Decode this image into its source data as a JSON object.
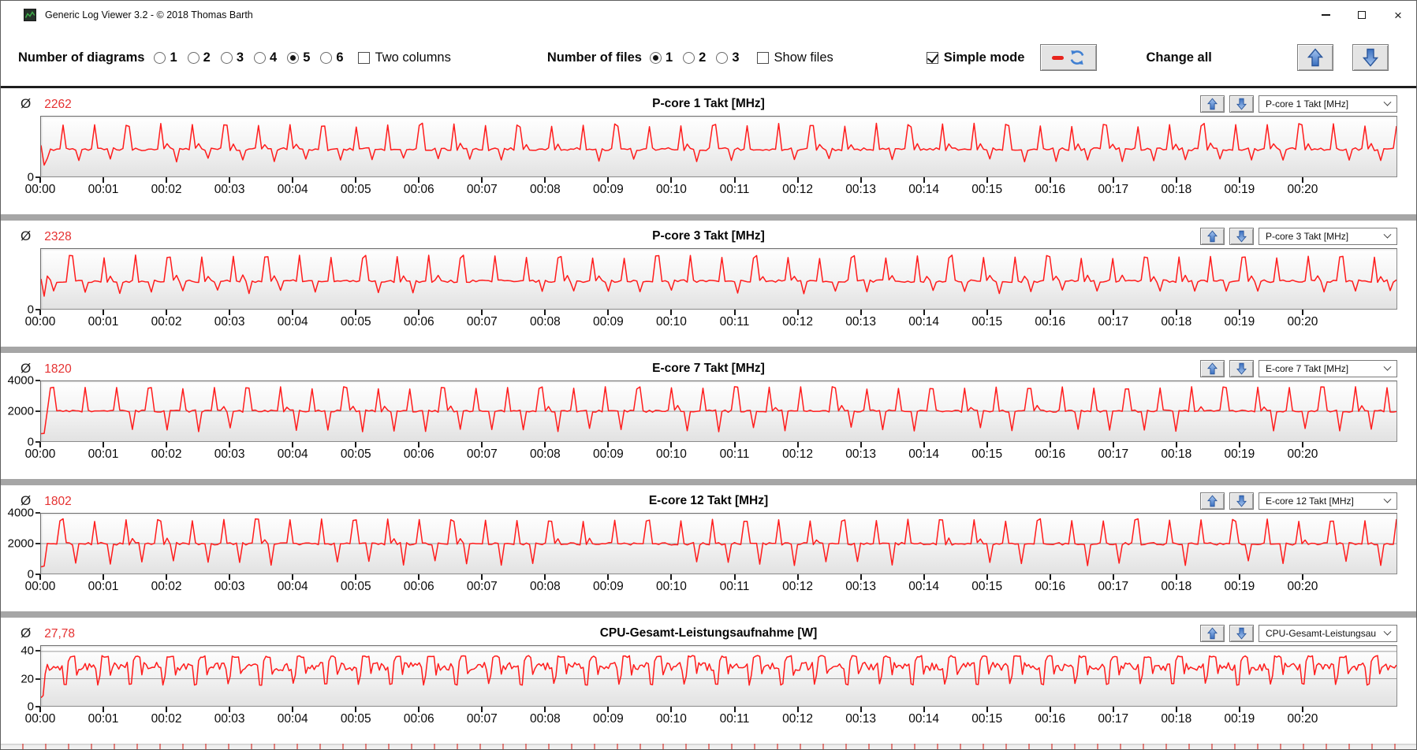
{
  "window": {
    "title": "Generic Log Viewer 3.2 - © 2018 Thomas Barth",
    "icons": {
      "app_icon": "green-line-chart-logo",
      "minimize": "minus-shape",
      "maximize": "square-outline",
      "close": "×"
    }
  },
  "toolbar": {
    "diagrams": {
      "name": "diagrams",
      "label": "Number of diagrams",
      "options": [
        "1",
        "2",
        "3",
        "4",
        "5",
        "6"
      ],
      "selected": "5"
    },
    "two_columns": {
      "label": "Two columns",
      "checked": false
    },
    "files": {
      "name": "files",
      "label": "Number of files",
      "options": [
        "1",
        "2",
        "3"
      ],
      "selected": "1"
    },
    "show_files": {
      "label": "Show files",
      "checked": false
    },
    "simple_mode": {
      "label": "Simple mode",
      "checked": true
    },
    "refresh_button_icons": [
      "red-line-icon",
      "refresh-arrows-icon"
    ],
    "change_all_label": "Change all",
    "accent_blue": "#3f7fd2",
    "accent_red": "#e8241d"
  },
  "labels": {
    "avg_symbol": "Ø"
  },
  "x_axis": {
    "labels": [
      "00:00",
      "00:01",
      "00:02",
      "00:03",
      "00:04",
      "00:05",
      "00:06",
      "00:07",
      "00:08",
      "00:09",
      "00:10",
      "00:11",
      "00:12",
      "00:13",
      "00:14",
      "00:15",
      "00:16",
      "00:17",
      "00:18",
      "00:19",
      "00:20"
    ],
    "tick_interval_seconds": 60,
    "domain_seconds": [
      0,
      1290
    ]
  },
  "chart_data": [
    {
      "type": "line",
      "title": "P-core 1 Takt [MHz]",
      "avg_value": "2262",
      "avg_numeric": 2262,
      "dropdown_value": "P-core 1 Takt [MHz]",
      "unit": "MHz",
      "line_color": "#ff1c1c",
      "ylim": [
        0,
        5000
      ],
      "y_ticks": [
        {
          "value": 0,
          "label": "0"
        }
      ],
      "gridlines": [],
      "series_pattern": {
        "approximation": true,
        "profile": "spiky",
        "seed": 11,
        "step_s": 3,
        "baseline": 2280,
        "noise": 120,
        "period_s": 31,
        "phase_s": 12,
        "spike_value": 4450,
        "spike_jitter": 320,
        "spike_width_s": 3.4,
        "dip_value": 1200,
        "dip_jitter": 350,
        "dip_width_s": 3,
        "dip_phase_s": 17,
        "dip_prob": 0.78,
        "bump_value": 2640,
        "bump_phase_s": 8,
        "bump_width_s": 2.6,
        "bump_prob": 0.55,
        "start_values": [
          2600,
          950
        ]
      }
    },
    {
      "type": "line",
      "title": "P-core 3 Takt [MHz]",
      "avg_value": "2328",
      "avg_numeric": 2328,
      "dropdown_value": "P-core 3 Takt [MHz]",
      "unit": "MHz",
      "line_color": "#ff1c1c",
      "ylim": [
        0,
        5000
      ],
      "y_ticks": [
        {
          "value": 0,
          "label": "0"
        }
      ],
      "gridlines": [],
      "series_pattern": {
        "approximation": true,
        "profile": "spiky",
        "seed": 22,
        "step_s": 3,
        "baseline": 2310,
        "noise": 110,
        "period_s": 31,
        "phase_s": 4,
        "spike_value": 4500,
        "spike_jitter": 300,
        "spike_width_s": 3.4,
        "dip_value": 1250,
        "dip_jitter": 330,
        "dip_width_s": 3,
        "dip_phase_s": 16,
        "dip_prob": 0.72,
        "bump_value": 2680,
        "bump_phase_s": 9,
        "bump_width_s": 2.6,
        "bump_prob": 0.5,
        "start_values": [
          2500,
          1050
        ]
      }
    },
    {
      "type": "line",
      "title": "E-core 7 Takt [MHz]",
      "avg_value": "1820",
      "avg_numeric": 1820,
      "dropdown_value": "E-core 7 Takt [MHz]",
      "unit": "MHz",
      "line_color": "#ff1c1c",
      "ylim": [
        0,
        4000
      ],
      "y_ticks": [
        {
          "value": 4000,
          "label": "4000"
        },
        {
          "value": 2000,
          "label": "2000"
        },
        {
          "value": 0,
          "label": "0"
        }
      ],
      "gridlines": [
        2000
      ],
      "series_pattern": {
        "approximation": true,
        "profile": "spiky",
        "seed": 33,
        "step_s": 3,
        "baseline": 2010,
        "noise": 75,
        "period_s": 31,
        "phase_s": 22,
        "spike_value": 3640,
        "spike_jitter": 160,
        "spike_width_s": 3.2,
        "dip_value": 620,
        "dip_jitter": 320,
        "dip_width_s": 3,
        "dip_phase_s": 17,
        "dip_prob": 0.8,
        "bump_value": 2240,
        "bump_phase_s": 9,
        "bump_width_s": 2.4,
        "bump_prob": 0.35,
        "start_values": [
          500,
          520
        ]
      }
    },
    {
      "type": "line",
      "title": "E-core 12 Takt [MHz]",
      "avg_value": "1802",
      "avg_numeric": 1802,
      "dropdown_value": "E-core 12 Takt [MHz]",
      "unit": "MHz",
      "line_color": "#ff1c1c",
      "ylim": [
        0,
        4000
      ],
      "y_ticks": [
        {
          "value": 4000,
          "label": "4000"
        },
        {
          "value": 2000,
          "label": "2000"
        },
        {
          "value": 0,
          "label": "0"
        }
      ],
      "gridlines": [
        2000
      ],
      "series_pattern": {
        "approximation": true,
        "profile": "spiky",
        "seed": 44,
        "step_s": 3,
        "baseline": 1990,
        "noise": 85,
        "period_s": 31,
        "phase_s": 13,
        "spike_value": 3660,
        "spike_jitter": 180,
        "spike_width_s": 3.2,
        "dip_value": 520,
        "dip_jitter": 340,
        "dip_width_s": 3,
        "dip_phase_s": 16,
        "dip_prob": 0.75,
        "bump_value": 2230,
        "bump_phase_s": 8,
        "bump_width_s": 2.4,
        "bump_prob": 0.3,
        "start_values": [
          450,
          500
        ]
      }
    },
    {
      "type": "line",
      "title": "CPU-Gesamt-Leistungsaufnahme [W]",
      "avg_value": "27,78",
      "avg_numeric": 27.78,
      "dropdown_value": "CPU-Gesamt-Leistungsau",
      "unit": "W",
      "line_color": "#ff1c1c",
      "ylim": [
        0,
        44
      ],
      "y_ticks": [
        {
          "value": 40,
          "label": "40"
        },
        {
          "value": 20,
          "label": "20"
        },
        {
          "value": 0,
          "label": "0"
        }
      ],
      "gridlines": [
        40,
        20
      ],
      "series_pattern": {
        "approximation": true,
        "profile": "power",
        "seed": 55,
        "step_s": 2,
        "period_s": 31,
        "phase_s": 9,
        "dip_value": 15.2,
        "dip_width_s": 2.4,
        "rise_width_s": 2,
        "plateau_value": 37,
        "plateau_jitter": 1.6,
        "plateau_end_s": 12,
        "post_drop_value": 22.5,
        "base_value": 28.6,
        "base_jitter": 3.1,
        "start_values": [
          6,
          7.5
        ]
      }
    }
  ]
}
